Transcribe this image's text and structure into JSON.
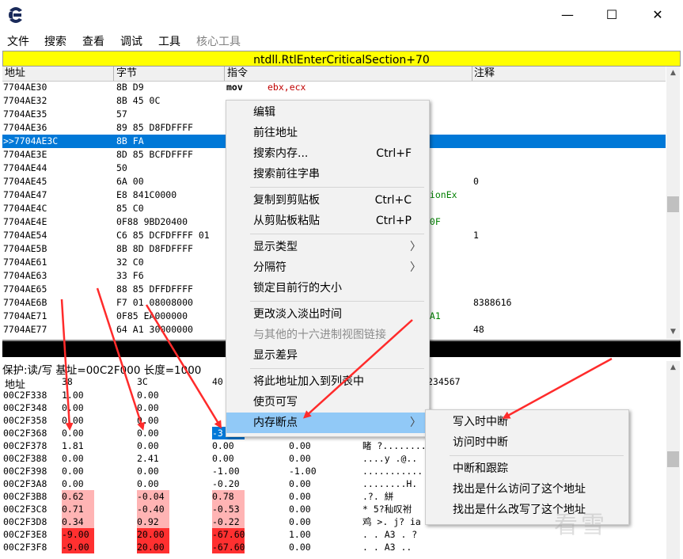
{
  "window": {
    "minimize": "—",
    "maximize": "☐",
    "close": "✕"
  },
  "menubar": [
    "文件",
    "搜索",
    "查看",
    "调试",
    "工具",
    "核心工具"
  ],
  "banner": "ntdll.RtlEnterCriticalSection+70",
  "disasm": {
    "columns": [
      "地址",
      "字节",
      "指令",
      "注释"
    ],
    "rows": [
      {
        "addr": "7704AE30",
        "bytes": "8B D9",
        "op": "mov",
        "args": "ebx,ecx",
        "comment": ""
      },
      {
        "addr": "7704AE32",
        "bytes": "8B 45 0C",
        "op": "",
        "args": "",
        "comment": ""
      },
      {
        "addr": "7704AE35",
        "bytes": "57",
        "op": "",
        "args": "",
        "comment": ""
      },
      {
        "addr": "7704AE36",
        "bytes": "89 85 D8FDFFFF",
        "op": "",
        "args": "",
        "comment": ""
      },
      {
        "addr": ">>7704AE3C",
        "bytes": "8B FA",
        "op": "",
        "args": "",
        "comment": ""
      },
      {
        "addr": "7704AE3E",
        "bytes": "8D 85 BCFDFFFF",
        "op": "",
        "args": "",
        "comment": ""
      },
      {
        "addr": "7704AE44",
        "bytes": "50",
        "op": "",
        "args": "",
        "comment": ""
      },
      {
        "addr": "7704AE45",
        "bytes": "6A 00",
        "op": "",
        "args": "",
        "comment": "0"
      },
      {
        "addr": "7704AE47",
        "bytes": "E8 841C0000",
        "op": "",
        "args": "tionEx",
        "comment": ""
      },
      {
        "addr": "7704AE4C",
        "bytes": "85 C0",
        "op": "",
        "args": "",
        "comment": ""
      },
      {
        "addr": "7704AE4E",
        "bytes": "0F88 9BD20400",
        "op": "",
        "args": "E0F",
        "comment": ""
      },
      {
        "addr": "7704AE54",
        "bytes": "C6 85 DCFDFFFF 01",
        "op": "",
        "args": "",
        "comment": "1"
      },
      {
        "addr": "7704AE5B",
        "bytes": "8B 8D D8FDFFFF",
        "op": "",
        "args": "",
        "comment": ""
      },
      {
        "addr": "7704AE61",
        "bytes": "32 C0",
        "op": "",
        "args": "",
        "comment": ""
      },
      {
        "addr": "7704AE63",
        "bytes": "33 F6",
        "op": "",
        "args": "",
        "comment": ""
      },
      {
        "addr": "7704AE65",
        "bytes": "88 85 DFFDFFFF",
        "op": "",
        "args": "",
        "comment": ""
      },
      {
        "addr": "7704AE6B",
        "bytes": "F7 01 08008000",
        "op": "",
        "args": "",
        "comment": "8388616"
      },
      {
        "addr": "7704AE71",
        "bytes": "0F85 EA000000",
        "op": "",
        "args": "1A1",
        "comment": ""
      },
      {
        "addr": "7704AE77",
        "bytes": "64 A1 30000000",
        "op": "",
        "args": "",
        "comment": "48"
      }
    ]
  },
  "hexview": {
    "info": "保护:读/写  基址=00C2F000 长度=1000",
    "header": {
      "addr": "地址",
      "c1": "38",
      "c2": "3C",
      "c3": "40",
      "tail": "234567"
    },
    "rows": [
      {
        "addr": "00C2F338",
        "v1": "1.00",
        "v2": "0.00",
        "v3": "",
        "v4": "",
        "ascii": "....",
        "hl": [
          "",
          "",
          "",
          ""
        ]
      },
      {
        "addr": "00C2F348",
        "v1": "0.00",
        "v2": "0.00",
        "v3": "",
        "v4": "",
        "ascii": "",
        "hl": [
          "",
          "",
          "",
          ""
        ]
      },
      {
        "addr": "00C2F358",
        "v1": "0.00",
        "v2": "0.00",
        "v3": "",
        "v4": "",
        "ascii": "",
        "hl": [
          "",
          "",
          "",
          ""
        ]
      },
      {
        "addr": "00C2F368",
        "v1": "0.00",
        "v2": "0.00",
        "v3": "-3",
        "v4": "",
        "ascii": "",
        "hl": [
          "",
          "",
          "sel",
          ""
        ]
      },
      {
        "addr": "00C2F378",
        "v1": "1.81",
        "v2": "0.00",
        "v3": "0.00",
        "v4": "0.00",
        "ascii": "睹 ?.........",
        "hl": [
          "",
          "",
          "",
          ""
        ]
      },
      {
        "addr": "00C2F388",
        "v1": "0.00",
        "v2": "2.41",
        "v3": "0.00",
        "v4": "0.00",
        "ascii": "....y .@..",
        "hl": [
          "",
          "",
          "",
          ""
        ]
      },
      {
        "addr": "00C2F398",
        "v1": "0.00",
        "v2": "0.00",
        "v3": "-1.00",
        "v4": "-1.00",
        "ascii": "........... A",
        "hl": [
          "",
          "",
          "",
          ""
        ]
      },
      {
        "addr": "00C2F3A8",
        "v1": "0.00",
        "v2": "0.00",
        "v3": "-0.20",
        "v4": "0.00",
        "ascii": "........H.",
        "hl": [
          "",
          "",
          "",
          ""
        ]
      },
      {
        "addr": "00C2F3B8",
        "v1": "0.62",
        "v2": "-0.04",
        "v3": "0.78",
        "v4": "0.00",
        "ascii": "  .?. 絣",
        "hl": [
          "pink",
          "pink",
          "pink",
          ""
        ]
      },
      {
        "addr": "00C2F3C8",
        "v1": "0.71",
        "v2": "-0.40",
        "v3": "-0.53",
        "v4": "0.00",
        "ascii": "* 5?秈叹祔",
        "hl": [
          "pink",
          "pink",
          "pink",
          ""
        ]
      },
      {
        "addr": "00C2F3D8",
        "v1": "0.34",
        "v2": "0.92",
        "v3": "-0.22",
        "v4": "0.00",
        "ascii": "鸡 >. j? ia",
        "hl": [
          "pink",
          "pink",
          "pink",
          ""
        ]
      },
      {
        "addr": "00C2F3E8",
        "v1": "-9.00",
        "v2": "20.00",
        "v3": "-67.60",
        "v4": "1.00",
        "ascii": ". . A3  . ?",
        "hl": [
          "red",
          "red",
          "red",
          ""
        ]
      },
      {
        "addr": "00C2F3F8",
        "v1": "-9.00",
        "v2": "20.00",
        "v3": "-67.60",
        "v4": "0.00",
        "ascii": ". . A3  ..",
        "hl": [
          "red",
          "red",
          "red",
          ""
        ]
      }
    ]
  },
  "context_menu": {
    "items": [
      {
        "label": "编辑",
        "shortcut": "",
        "submenu": false,
        "disabled": false
      },
      {
        "label": "前往地址",
        "shortcut": "",
        "submenu": false,
        "disabled": false
      },
      {
        "label": "搜索内存...",
        "shortcut": "Ctrl+F",
        "submenu": false,
        "disabled": false
      },
      {
        "label": "搜索前往字串",
        "shortcut": "",
        "submenu": false,
        "disabled": false
      },
      {
        "sep": true
      },
      {
        "label": "复制到剪贴板",
        "shortcut": "Ctrl+C",
        "submenu": false,
        "disabled": false
      },
      {
        "label": "从剪贴板粘贴",
        "shortcut": "Ctrl+P",
        "submenu": false,
        "disabled": false
      },
      {
        "sep": true
      },
      {
        "label": "显示类型",
        "shortcut": "",
        "submenu": true,
        "disabled": false
      },
      {
        "label": "分隔符",
        "shortcut": "",
        "submenu": true,
        "disabled": false
      },
      {
        "label": "锁定目前行的大小",
        "shortcut": "",
        "submenu": false,
        "disabled": false
      },
      {
        "sep": true
      },
      {
        "label": "更改淡入淡出时间",
        "shortcut": "",
        "submenu": false,
        "disabled": false
      },
      {
        "label": "与其他的十六进制视图链接",
        "shortcut": "",
        "submenu": false,
        "disabled": true
      },
      {
        "label": "显示差异",
        "shortcut": "",
        "submenu": false,
        "disabled": false
      },
      {
        "sep": true
      },
      {
        "label": "将此地址加入到列表中",
        "shortcut": "",
        "submenu": false,
        "disabled": false
      },
      {
        "label": "使页可写",
        "shortcut": "",
        "submenu": false,
        "disabled": false
      },
      {
        "label": "内存断点",
        "shortcut": "",
        "submenu": true,
        "disabled": false,
        "hover": true
      }
    ]
  },
  "sub_menu": {
    "items": [
      {
        "label": "写入时中断"
      },
      {
        "label": "访问时中断"
      },
      {
        "sep": true
      },
      {
        "label": "中断和跟踪"
      },
      {
        "label": "找出是什么访问了这个地址"
      },
      {
        "label": "找出是什么改写了这个地址"
      }
    ]
  },
  "watermark": "看雪",
  "colors": {
    "selection": "#0078d7",
    "banner": "#ffff00",
    "arrow": "#ff2b2b",
    "hover": "#91c9f7"
  }
}
